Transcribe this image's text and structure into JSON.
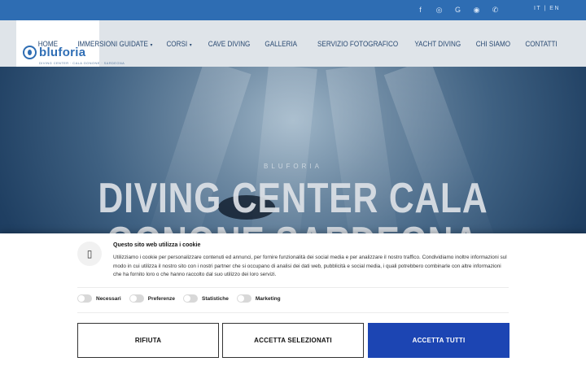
{
  "topbar": {
    "social_icons": [
      "facebook-icon",
      "instagram-icon",
      "google-icon",
      "whatsapp-icon",
      "phone-icon"
    ],
    "social_glyphs": [
      "f",
      "◎",
      "G",
      "◉",
      "✆"
    ],
    "lang": "IT | EN"
  },
  "logo": {
    "name": "bluforia",
    "tagline": "DIVING CENTER · CALA GONONE · SARDEGNA"
  },
  "nav": {
    "items": [
      {
        "label": "HOME",
        "has_caret": false
      },
      {
        "label": "IMMERSIONI GUIDATE",
        "has_caret": true
      },
      {
        "label": "CORSI",
        "has_caret": true
      },
      {
        "label": "CAVE DIVING",
        "has_caret": false
      },
      {
        "label": "GALLERIA",
        "has_caret": false
      },
      {
        "label": "SERVIZIO FOTOGRAFICO",
        "has_caret": false
      },
      {
        "label": "YACHT DIVING",
        "has_caret": false
      },
      {
        "label": "CHI SIAMO",
        "has_caret": false
      },
      {
        "label": "CONTATTI",
        "has_caret": false
      }
    ]
  },
  "hero": {
    "eyebrow": "BLUFORIA",
    "title_line1": "DIVING CENTER CALA",
    "title_line2": "GONONE SARDEGNA"
  },
  "cookie": {
    "heading": "Questo sito web utilizza i cookie",
    "text": "Utilizziamo i cookie per personalizzare contenuti ed annunci, per fornire funzionalità dei social media e per analizzare il nostro traffico. Condividiamo inoltre informazioni sul modo in cui utilizza il nostro sito con i nostri partner che si occupano di analisi dei dati web, pubblicità e social media, i quali potrebbero combinarle con altre informazioni che ha fornito loro o che hanno raccolto dal suo utilizzo dei loro servizi.",
    "toggles": [
      "Necessari",
      "Preferenze",
      "Statistiche",
      "Marketing"
    ],
    "buttons": {
      "reject": "RIFIUTA",
      "accept_selected": "ACCETTA SELEZIONATI",
      "accept_all": "ACCETTA TUTTI"
    },
    "accent_color": "#1c45b3"
  }
}
